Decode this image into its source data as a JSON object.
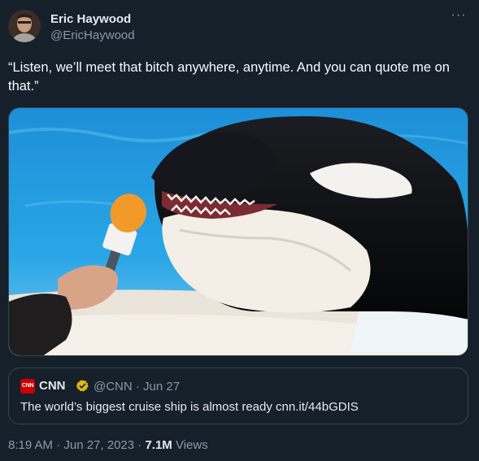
{
  "author": {
    "display_name": "Eric Haywood",
    "handle": "@EricHaywood",
    "avatar_icon": "profile-photo"
  },
  "more_icon": "more-horizontal-icon",
  "tweet": {
    "text": "“Listen, we’ll meet that bitch anywhere, anytime. And you can quote me on that.”"
  },
  "media": {
    "icon": "photo-orca-interview"
  },
  "quoted_tweet": {
    "logo_text": "CNN",
    "name": "CNN",
    "verified_icon": "gold-verified-badge-icon",
    "meta": "@CNN · Jun 27",
    "text": "The world’s biggest cruise ship is almost ready cnn.it/44bGDIS"
  },
  "footer": {
    "timestamp": "8:19 AM · Jun 27, 2023 · ",
    "views_count": "7.1M",
    "views_label": " Views"
  },
  "colors": {
    "background": "#15202b",
    "secondary_text": "#8b98a5",
    "border": "#38444d",
    "cnn_red": "#cc0000",
    "verified_gold": "#e2b719"
  }
}
